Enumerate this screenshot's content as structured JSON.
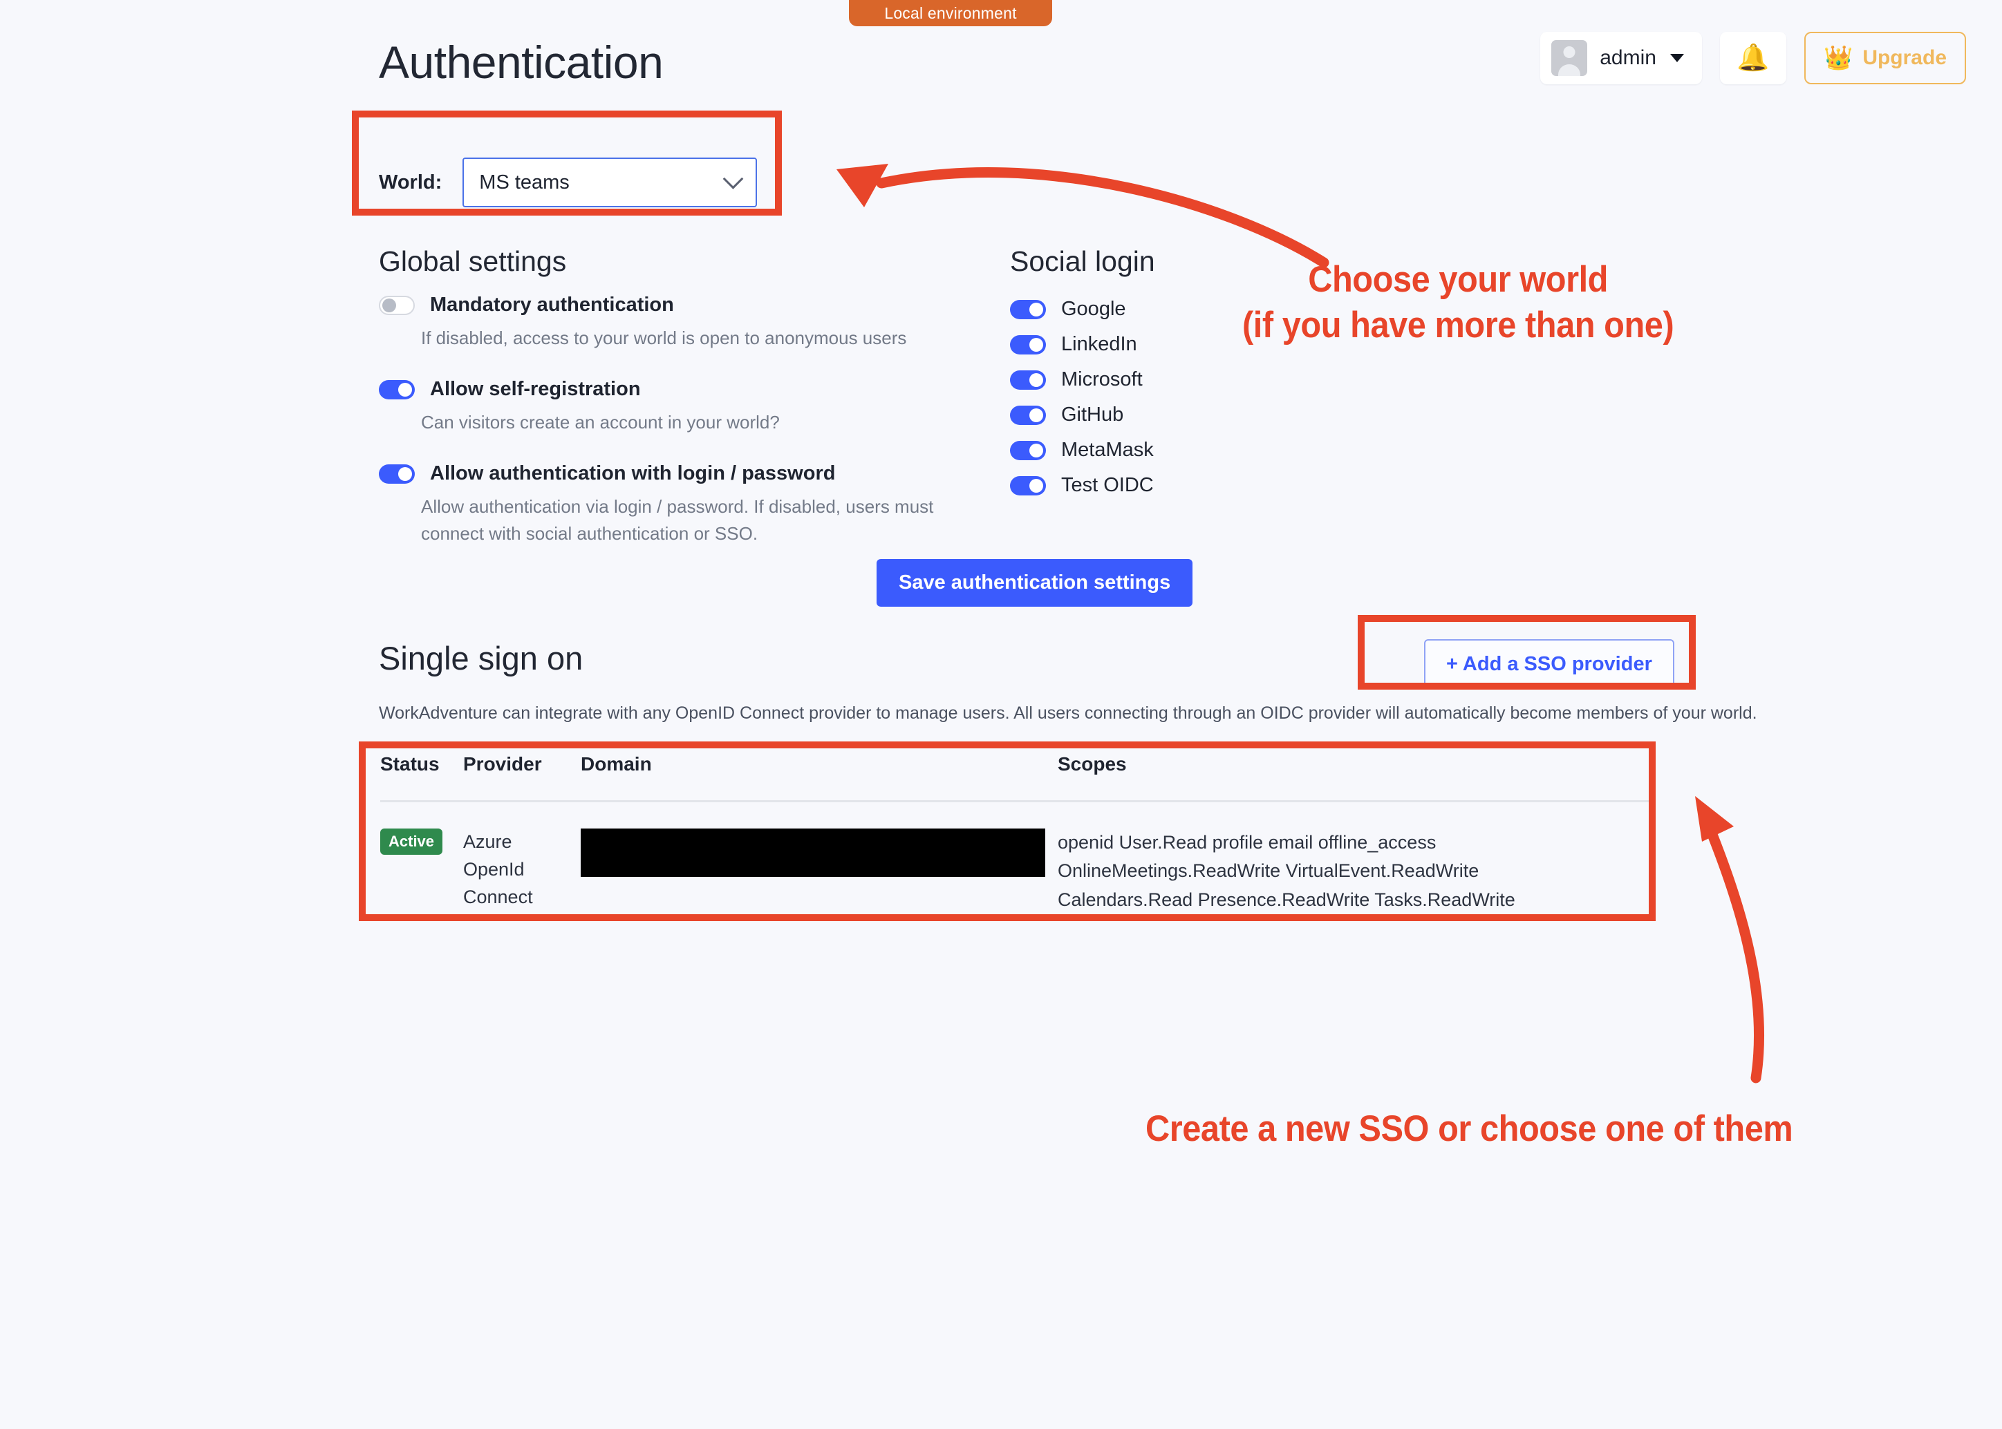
{
  "env_banner": "Local environment",
  "header": {
    "title": "Authentication",
    "user_name": "admin",
    "bell_icon": "bell-icon",
    "upgrade_icon": "crown-icon",
    "upgrade_label": "Upgrade"
  },
  "world": {
    "label": "World:",
    "selected": "MS teams"
  },
  "global_settings": {
    "heading": "Global settings",
    "items": [
      {
        "title": "Mandatory authentication",
        "desc": "If disabled, access to your world is open to anonymous users",
        "enabled": false
      },
      {
        "title": "Allow self-registration",
        "desc": "Can visitors create an account in your world?",
        "enabled": true
      },
      {
        "title": "Allow authentication with login / password",
        "desc": "Allow authentication via login / password. If disabled, users must connect with social authentication or SSO.",
        "enabled": true
      }
    ]
  },
  "social_login": {
    "heading": "Social login",
    "items": [
      {
        "label": "Google",
        "enabled": true
      },
      {
        "label": "LinkedIn",
        "enabled": true
      },
      {
        "label": "Microsoft",
        "enabled": true
      },
      {
        "label": "GitHub",
        "enabled": true
      },
      {
        "label": "MetaMask",
        "enabled": true
      },
      {
        "label": "Test OIDC",
        "enabled": true
      }
    ]
  },
  "save_button": "Save authentication settings",
  "sso": {
    "heading": "Single sign on",
    "description": "WorkAdventure can integrate with any OpenID Connect provider to manage users. All users connecting through an OIDC provider will automatically become members of your world.",
    "add_button": "+ Add a SSO provider",
    "columns": [
      "Status",
      "Provider",
      "Domain",
      "Scopes"
    ],
    "rows": [
      {
        "status": "Active",
        "provider": "Azure OpenId Connect",
        "domain": "",
        "scopes": "openid User.Read profile email offline_access OnlineMeetings.ReadWrite VirtualEvent.ReadWrite Calendars.Read Presence.ReadWrite Tasks.ReadWrite"
      }
    ]
  },
  "annotations": {
    "world_text": "Choose your world\n(if you have more than one)",
    "sso_text": "Create a new SSO or choose one of them",
    "color": "#e8452a"
  }
}
